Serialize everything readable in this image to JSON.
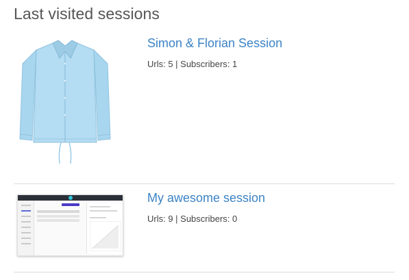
{
  "page": {
    "heading": "Last visited sessions"
  },
  "sessions": [
    {
      "title": "Simon & Florian Session",
      "meta": "Urls: 5 | Subscribers: 1",
      "thumbnail": "jacket-photo"
    },
    {
      "title": "My awesome session",
      "meta": "Urls: 9 | Subscribers: 0",
      "thumbnail": "dashboard-screenshot"
    }
  ],
  "colors": {
    "link": "#3c83c5",
    "heading": "#555555",
    "text": "#444444",
    "divider": "#dcdcdc",
    "jacket": "#a9d6ef"
  }
}
